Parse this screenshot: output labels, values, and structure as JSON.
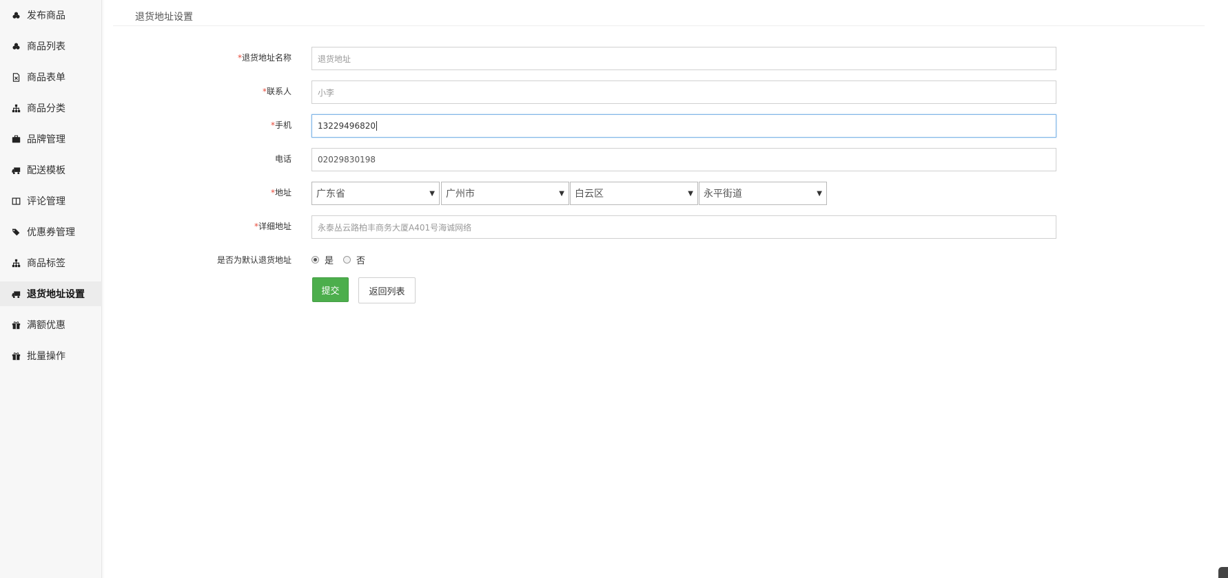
{
  "sidebar": {
    "items": [
      {
        "label": "发布商品",
        "icon": "cubes-icon"
      },
      {
        "label": "商品列表",
        "icon": "cubes-icon"
      },
      {
        "label": "商品表单",
        "icon": "file-excel-icon"
      },
      {
        "label": "商品分类",
        "icon": "sitemap-icon"
      },
      {
        "label": "品牌管理",
        "icon": "briefcase-icon"
      },
      {
        "label": "配送模板",
        "icon": "truck-icon"
      },
      {
        "label": "评论管理",
        "icon": "columns-icon"
      },
      {
        "label": "优惠券管理",
        "icon": "tags-icon"
      },
      {
        "label": "商品标签",
        "icon": "sitemap-icon"
      },
      {
        "label": "退货地址设置",
        "icon": "truck-icon",
        "active": true
      },
      {
        "label": "满额优惠",
        "icon": "gift-icon"
      },
      {
        "label": "批量操作",
        "icon": "gift-icon"
      }
    ]
  },
  "page": {
    "title": "退货地址设置"
  },
  "form": {
    "name": {
      "label": "退货地址名称",
      "required": "*",
      "placeholder": "退货地址"
    },
    "contact": {
      "label": "联系人",
      "required": "*",
      "value": "小李"
    },
    "mobile": {
      "label": "手机",
      "required": "*",
      "value": "13229496820"
    },
    "phone": {
      "label": "电话",
      "value": "02029830198"
    },
    "address": {
      "label": "地址",
      "required": "*",
      "province": "广东省",
      "city": "广州市",
      "district": "白云区",
      "street": "永平街道"
    },
    "detail": {
      "label": "详细地址",
      "required": "*",
      "placeholder": "永泰丛云路柏丰商务大厦A401号海诚网络"
    },
    "default": {
      "label": "是否为默认退货地址",
      "yes": "是",
      "no": "否",
      "selected": "是"
    }
  },
  "buttons": {
    "submit": "提交",
    "back": "返回列表"
  },
  "colors": {
    "primary_button": "#4cae4c",
    "required": "#e74c3c",
    "focus": "#7fb4e6"
  }
}
